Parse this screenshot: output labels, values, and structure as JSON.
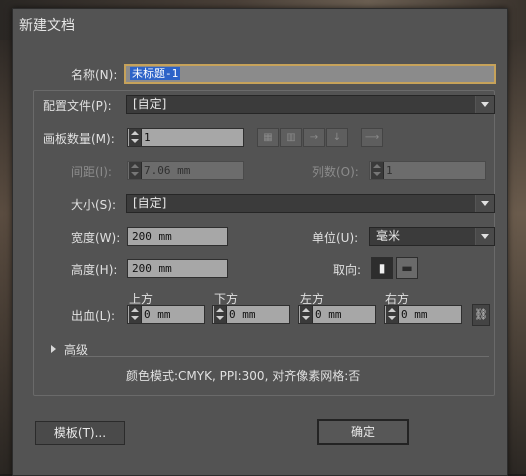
{
  "dialog": {
    "title": "新建文档",
    "name_label": "名称(N):",
    "name_value": "未标题-1",
    "profile_label": "配置文件(P):",
    "profile_value": "[自定]",
    "artboards_label": "画板数量(M):",
    "artboards_value": "1",
    "spacing_label": "间距(I):",
    "spacing_value": "7.06 mm",
    "columns_label": "列数(O):",
    "columns_value": "1",
    "size_label": "大小(S):",
    "size_value": "[自定]",
    "width_label": "宽度(W):",
    "width_value": "200 mm",
    "units_label": "单位(U):",
    "units_value": "毫米",
    "height_label": "高度(H):",
    "height_value": "200 mm",
    "orientation_label": "取向:",
    "bleed_label": "出血(L):",
    "bleed": {
      "top_label": "上方",
      "top_value": "0 mm",
      "bottom_label": "下方",
      "bottom_value": "0 mm",
      "left_label": "左方",
      "left_value": "0 mm",
      "right_label": "右方",
      "right_value": "0 mm"
    },
    "advanced_label": "高级",
    "summary": "颜色模式:CMYK, PPI:300, 对齐像素网格:否",
    "templates_button": "模板(T)...",
    "ok_button": "确定"
  },
  "icons": {
    "arrange_grid_by_row": "grid-by-row-icon",
    "arrange_grid_by_column": "grid-by-column-icon",
    "arrange_by_row": "arrange-by-row-icon",
    "arrange_by_column": "arrange-by-column-icon",
    "layout_direction": "layout-direction-icon",
    "portrait": "portrait-icon",
    "landscape": "landscape-icon",
    "link_bleed": "chain-link-icon"
  },
  "colors": {
    "dialog_bg": "#535353",
    "field_bg": "#a7a7a7",
    "selection": "#2d63c8",
    "focus_border": "#c6a25a"
  }
}
